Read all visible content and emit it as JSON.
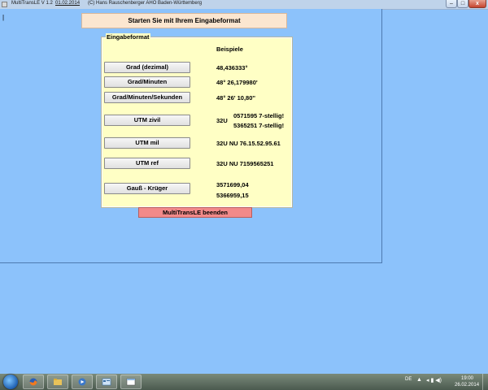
{
  "titlebar": {
    "title": "MultiTransLE  V 1.2",
    "date": "01.02.2014",
    "credit": "(C) Hans Rauschenberger  AHO Baden-Württemberg",
    "min_glyph": "–",
    "max_glyph": "□",
    "close_glyph": "x"
  },
  "main": {
    "caret": "|",
    "header": "Starten Sie mit Ihrem Eingabeformat",
    "group": {
      "legend": "Eingabeformat",
      "examples_header": "Beispiele",
      "rows": [
        {
          "button": "Grad (dezimal)",
          "example": "48,436333°"
        },
        {
          "button": "Grad/Minuten",
          "example": "48°  26,179980'"
        },
        {
          "button": "Grad/Minuten/Sekunden",
          "example": "48°  26'  10,80''"
        },
        {
          "button": "UTM zivil",
          "zone": "32U",
          "line1": "0571595   7-stellig!",
          "line2": "5365251   7-stellig!"
        },
        {
          "button": "UTM mil",
          "example": "32U  NU  76.15.52.95.61"
        },
        {
          "button": "UTM ref",
          "example": "32U  NU  7159565251"
        },
        {
          "button": "Gauß - Krüger",
          "line1": "3571699,04",
          "line2": "5366959,15"
        }
      ]
    },
    "quit_button": "MultiTransLE beenden"
  },
  "taskbar": {
    "items": [
      "firefox-icon",
      "explorer-icon",
      "media-icon",
      "control-panel-icon",
      "window-icon"
    ],
    "tray_lang": "DE",
    "tray_flag": "▲",
    "tray_icons": "◂ ▮ ◀)",
    "clock_time": "19:00",
    "clock_date": "26.02.2014"
  }
}
